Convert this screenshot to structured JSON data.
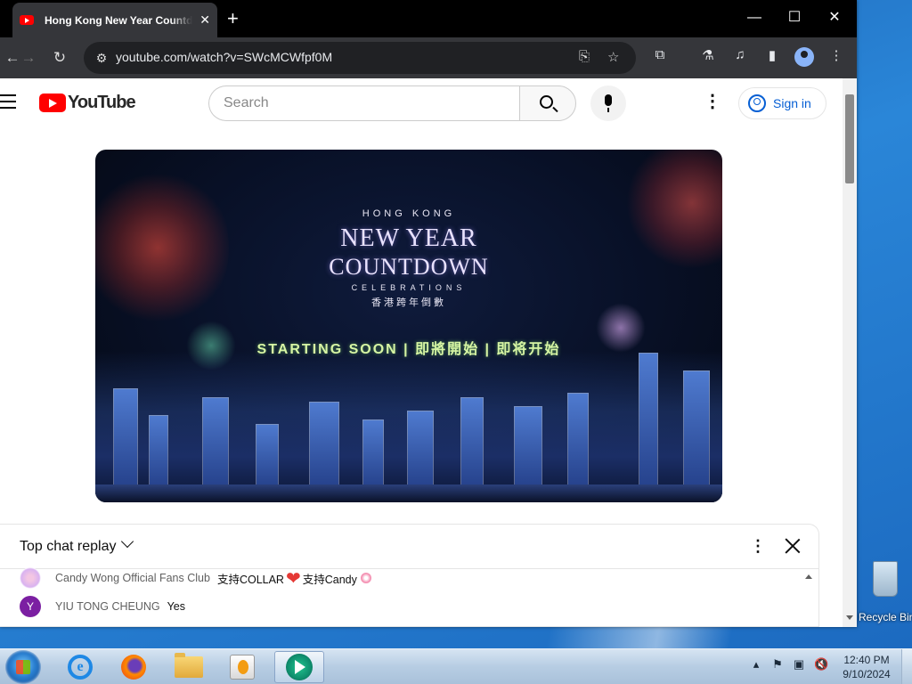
{
  "browser": {
    "tab_title": "Hong Kong New Year Countdown Celebrations",
    "url": "youtube.com/watch?v=SWcMCWfpf0M"
  },
  "youtube": {
    "logo_text": "YouTube",
    "search_placeholder": "Search",
    "sign_in_label": "Sign in"
  },
  "video": {
    "line1": "HONG KONG",
    "line2": "NEW YEAR",
    "line3": "COUNTDOWN",
    "line4": "CELEBRATIONS",
    "line5": "香港跨年倒數",
    "status": "STARTING SOON  |  即將開始  |  即将开始"
  },
  "chat": {
    "mode_label": "Top chat replay",
    "messages": [
      {
        "author": "Candy Wong Official Fans Club",
        "text_a": "支持COLLAR",
        "text_b": "支持Candy",
        "avatar": ""
      },
      {
        "author": "YIU TONG CHEUNG",
        "text_a": "Yes",
        "avatar": "Y"
      }
    ]
  },
  "desktop": {
    "recycle_bin_label": "Recycle Bin"
  },
  "taskbar": {
    "clock_time": "12:40 PM",
    "clock_date": "9/10/2024"
  },
  "colors": {
    "youtube_red": "#ff0000",
    "link_blue": "#065fd4",
    "chrome_dark": "#35363a"
  },
  "icons": [
    "search-icon",
    "mic-icon",
    "kebab-menu-icon",
    "account-icon",
    "close-icon",
    "chevron-down-icon",
    "heart-emoji",
    "lollipop-emoji"
  ]
}
